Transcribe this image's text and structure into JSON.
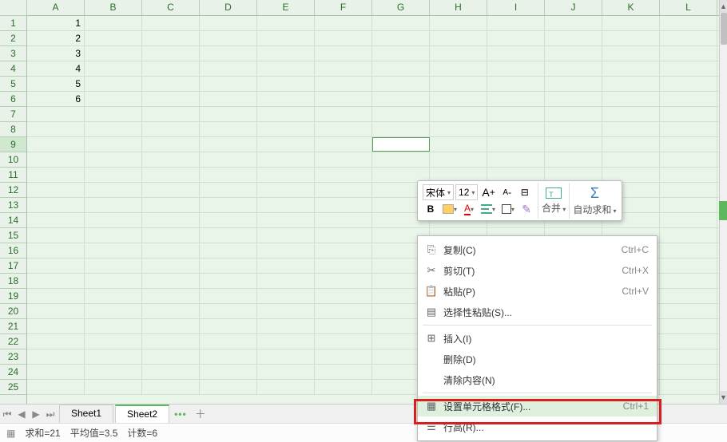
{
  "columns": [
    "A",
    "B",
    "C",
    "D",
    "E",
    "F",
    "G",
    "H",
    "I",
    "J",
    "K",
    "L"
  ],
  "rows": [
    1,
    2,
    3,
    4,
    5,
    6,
    7,
    8,
    9,
    10,
    11,
    12,
    13,
    14,
    15,
    16,
    17,
    18,
    19,
    20,
    21,
    22,
    23,
    24,
    25
  ],
  "cellData": {
    "A1": "1",
    "A2": "2",
    "A3": "3",
    "A4": "4",
    "A5": "5",
    "A6": "6"
  },
  "activeCell": {
    "row": 9,
    "col": "G"
  },
  "sheetTabs": [
    {
      "name": "Sheet1",
      "active": false
    },
    {
      "name": "Sheet2",
      "active": true
    }
  ],
  "statusBar": {
    "sum": "求和=21",
    "avg": "平均值=3.5",
    "count": "计数=6"
  },
  "miniToolbar": {
    "font": "宋体",
    "size": "12",
    "increaseFont": "A",
    "decreaseFont": "A",
    "bold": "B",
    "merge": "合并",
    "autosum": "自动求和"
  },
  "contextMenu": [
    {
      "icon": "copy",
      "label": "复制(C)",
      "shortcut": "Ctrl+C"
    },
    {
      "icon": "cut",
      "label": "剪切(T)",
      "shortcut": "Ctrl+X"
    },
    {
      "icon": "paste",
      "label": "粘贴(P)",
      "shortcut": "Ctrl+V"
    },
    {
      "icon": "paste-special",
      "label": "选择性粘贴(S)...",
      "shortcut": ""
    },
    {
      "sep": true
    },
    {
      "icon": "insert",
      "label": "插入(I)",
      "shortcut": ""
    },
    {
      "icon": "",
      "label": "删除(D)",
      "shortcut": ""
    },
    {
      "icon": "",
      "label": "清除内容(N)",
      "shortcut": ""
    },
    {
      "sep": true
    },
    {
      "icon": "format",
      "label": "设置单元格格式(F)...",
      "shortcut": "Ctrl+1",
      "highlight": true
    },
    {
      "icon": "rowh",
      "label": "行高(R)...",
      "shortcut": ""
    }
  ]
}
